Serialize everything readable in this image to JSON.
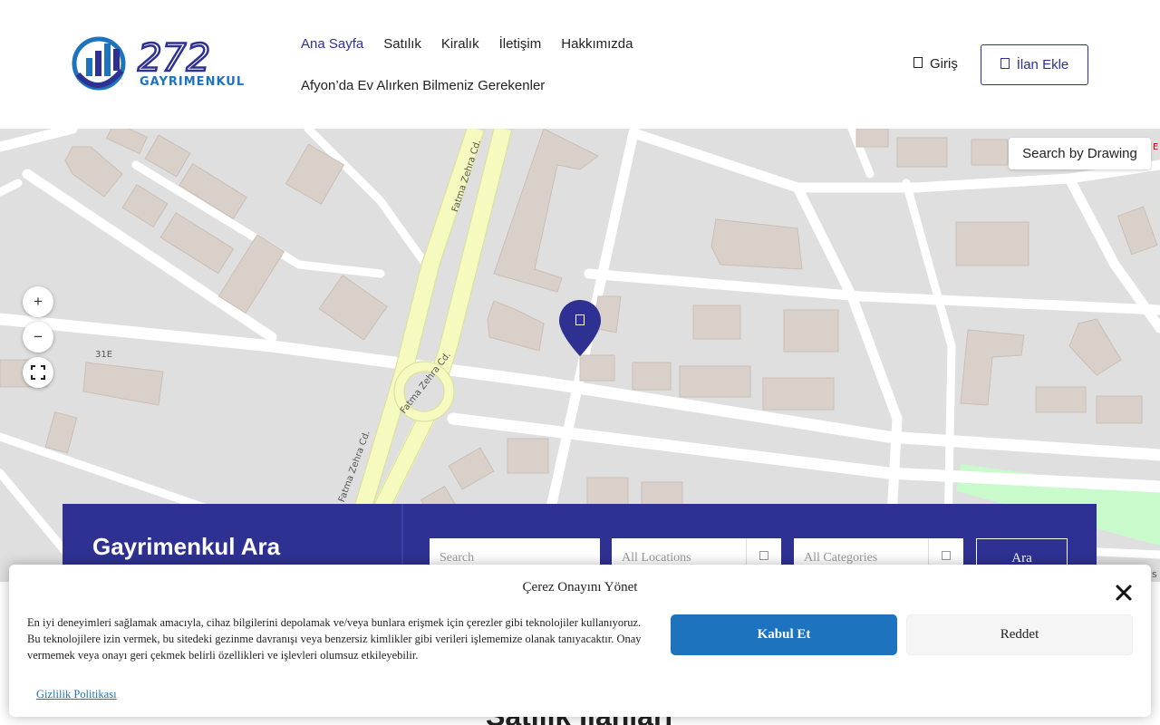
{
  "header": {
    "logo_text_number": "272",
    "logo_text_brand": "GAYRIMENKUL",
    "nav_row1": [
      "Ana Sayfa",
      "Satılık",
      "Kiralık",
      "İletişim",
      "Hakkımızda"
    ],
    "nav_row2": [
      "Afyon’da Ev Alırken Bilmeniz Gerekenler"
    ],
    "login_label": "Giriş",
    "add_listing_label": "İlan Ekle",
    "brand_color": "#2e3192",
    "accent_color": "#1e73be"
  },
  "map": {
    "zoom_in": "+",
    "zoom_out": "−",
    "search_by_drawing": "Search by Drawing",
    "street_labels": [
      "Fatma Zehra Cd.",
      "Fatma Zehra Cd.",
      "Fatma Zehra Cd."
    ],
    "road_code": "31E",
    "edge_text": "E",
    "edge_text_right": "s"
  },
  "search": {
    "title": "Gayrimenkul Ara",
    "keyword_placeholder": "Search",
    "location_placeholder": "All Locations",
    "category_placeholder": "All Categories",
    "submit_label": "Ara"
  },
  "behind_heading": "Satılık İlanları",
  "cookie": {
    "title": "Çerez Onayını Yönet",
    "text": "En iyi deneyimleri sağlamak amacıyla, cihaz bilgilerini depolamak ve/veya bunlara erişmek için çerezler gibi teknolojiler kullanıyoruz. Bu teknolojilere izin vermek, bu sitedeki gezinme davranışı veya benzersiz kimlikler gibi verileri işlememize olanak tanıyacaktır. Onay vermemek veya onayı geri çekmek belirli özellikleri ve işlevleri olumsuz etkileyebilir.",
    "accept_label": "Kabul Et",
    "reject_label": "Reddet",
    "policy_label": "Gizlilik Politikası"
  }
}
